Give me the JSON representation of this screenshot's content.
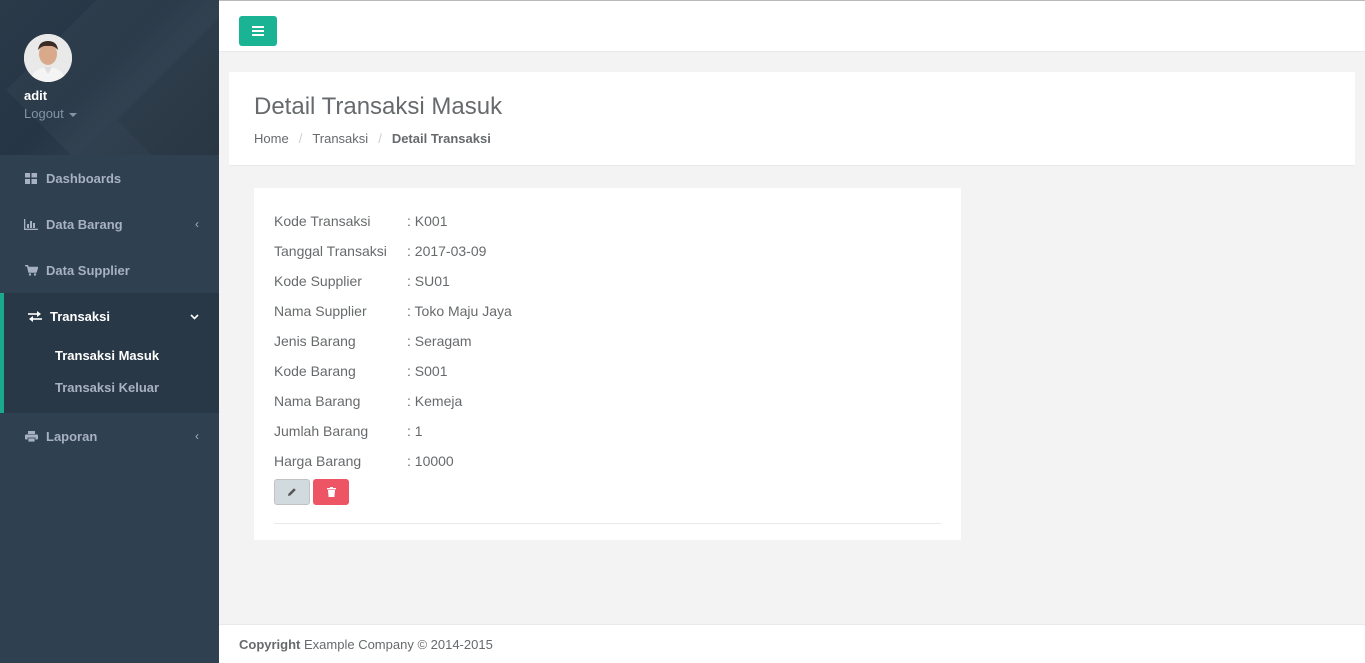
{
  "sidebar": {
    "profile": {
      "name": "adit",
      "logout_label": "Logout"
    },
    "items": [
      {
        "label": "Dashboards",
        "icon": "dashboard-icon"
      },
      {
        "label": "Data Barang",
        "icon": "bar-chart-icon",
        "arrow": "‹"
      },
      {
        "label": "Data Supplier",
        "icon": "cart-icon"
      },
      {
        "label": "Transaksi",
        "icon": "exchange-icon",
        "arrow": "⌄",
        "children": [
          {
            "label": "Transaksi Masuk"
          },
          {
            "label": "Transaksi Keluar"
          }
        ]
      },
      {
        "label": "Laporan",
        "icon": "print-icon",
        "arrow": "‹"
      }
    ]
  },
  "page": {
    "title": "Detail Transaksi Masuk",
    "breadcrumb": [
      "Home",
      "Transaksi",
      "Detail Transaksi"
    ]
  },
  "detail": {
    "rows": [
      {
        "label": "Kode Transaksi",
        "value": ": K001"
      },
      {
        "label": "Tanggal Transaksi",
        "value": ": 2017-03-09"
      },
      {
        "label": "Kode Supplier",
        "value": ": SU01"
      },
      {
        "label": "Nama Supplier",
        "value": ": Toko Maju Jaya"
      },
      {
        "label": "Jenis Barang",
        "value": ": Seragam"
      },
      {
        "label": "Kode Barang",
        "value": ": S001"
      },
      {
        "label": "Nama Barang",
        "value": ": Kemeja"
      },
      {
        "label": "Jumlah Barang",
        "value": ": 1"
      },
      {
        "label": "Harga Barang",
        "value": ": 10000"
      }
    ]
  },
  "footer": {
    "bold": "Copyright",
    "text": " Example Company © 2014-2015"
  },
  "colors": {
    "sidebar": "#2f4050",
    "accent": "#1ab394",
    "danger": "#ed5565",
    "background": "#f3f3f4"
  }
}
